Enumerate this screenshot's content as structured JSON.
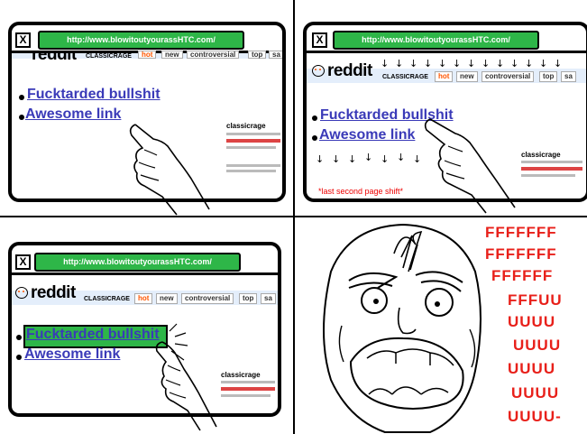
{
  "url": "http://www.blowitoutyourassHTC.com/",
  "close_label": "X",
  "reddit": {
    "logo_text": "reddit",
    "subreddit": "CLASSICRAGE",
    "tabs": [
      "hot",
      "new",
      "controversial",
      "top",
      "sa"
    ]
  },
  "links": [
    "Fucktarded bullshit",
    "Awesome link"
  ],
  "sidebar_title": "classicrage",
  "arrow_glyph": "↓",
  "note": "*last second page shift*",
  "rage_lines": [
    "FFFFFFF",
    "FFFFFFF",
    "FFFFFF",
    "FFFUU",
    "UUUU",
    "UUUU",
    "UUUU",
    "UUUU",
    "UUUU-"
  ],
  "colors": {
    "url_bar": "#2eb648",
    "link": "#3a3ab8",
    "rage": "#e8201a",
    "note": "#e00000"
  }
}
